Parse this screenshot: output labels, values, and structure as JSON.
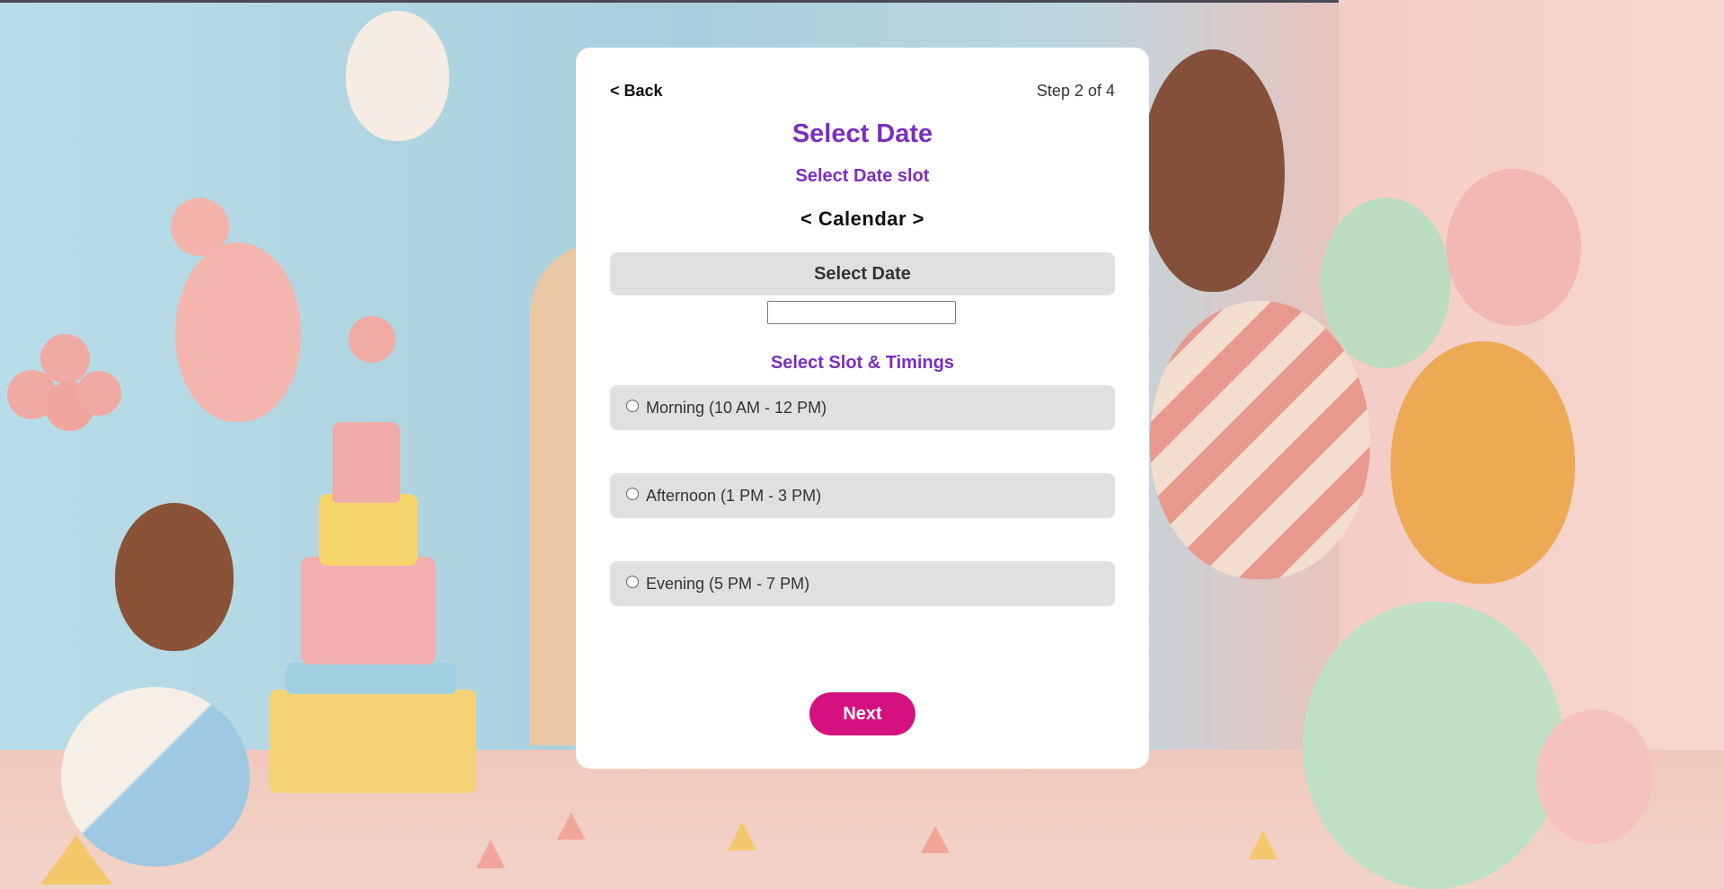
{
  "header": {
    "back_label": "< Back",
    "step_text": "Step 2 of 4"
  },
  "main": {
    "title": "Select Date",
    "subtitle": "Select Date slot",
    "calendar_label": "< Calendar >",
    "select_date_label": "Select Date",
    "date_input": {
      "value": "",
      "placeholder": ""
    },
    "slot_title": "Select Slot & Timings",
    "slots": [
      {
        "label": "Morning (10 AM - 12 PM)",
        "selected": false
      },
      {
        "label": "Afternoon (1 PM - 3 PM)",
        "selected": false
      },
      {
        "label": "Evening (5 PM - 7 PM)",
        "selected": false
      }
    ],
    "next_label": "Next"
  },
  "colors": {
    "accent_purple": "#7a2ec0",
    "next_button": "#d4117e",
    "slot_bg": "#e0e0e0"
  }
}
